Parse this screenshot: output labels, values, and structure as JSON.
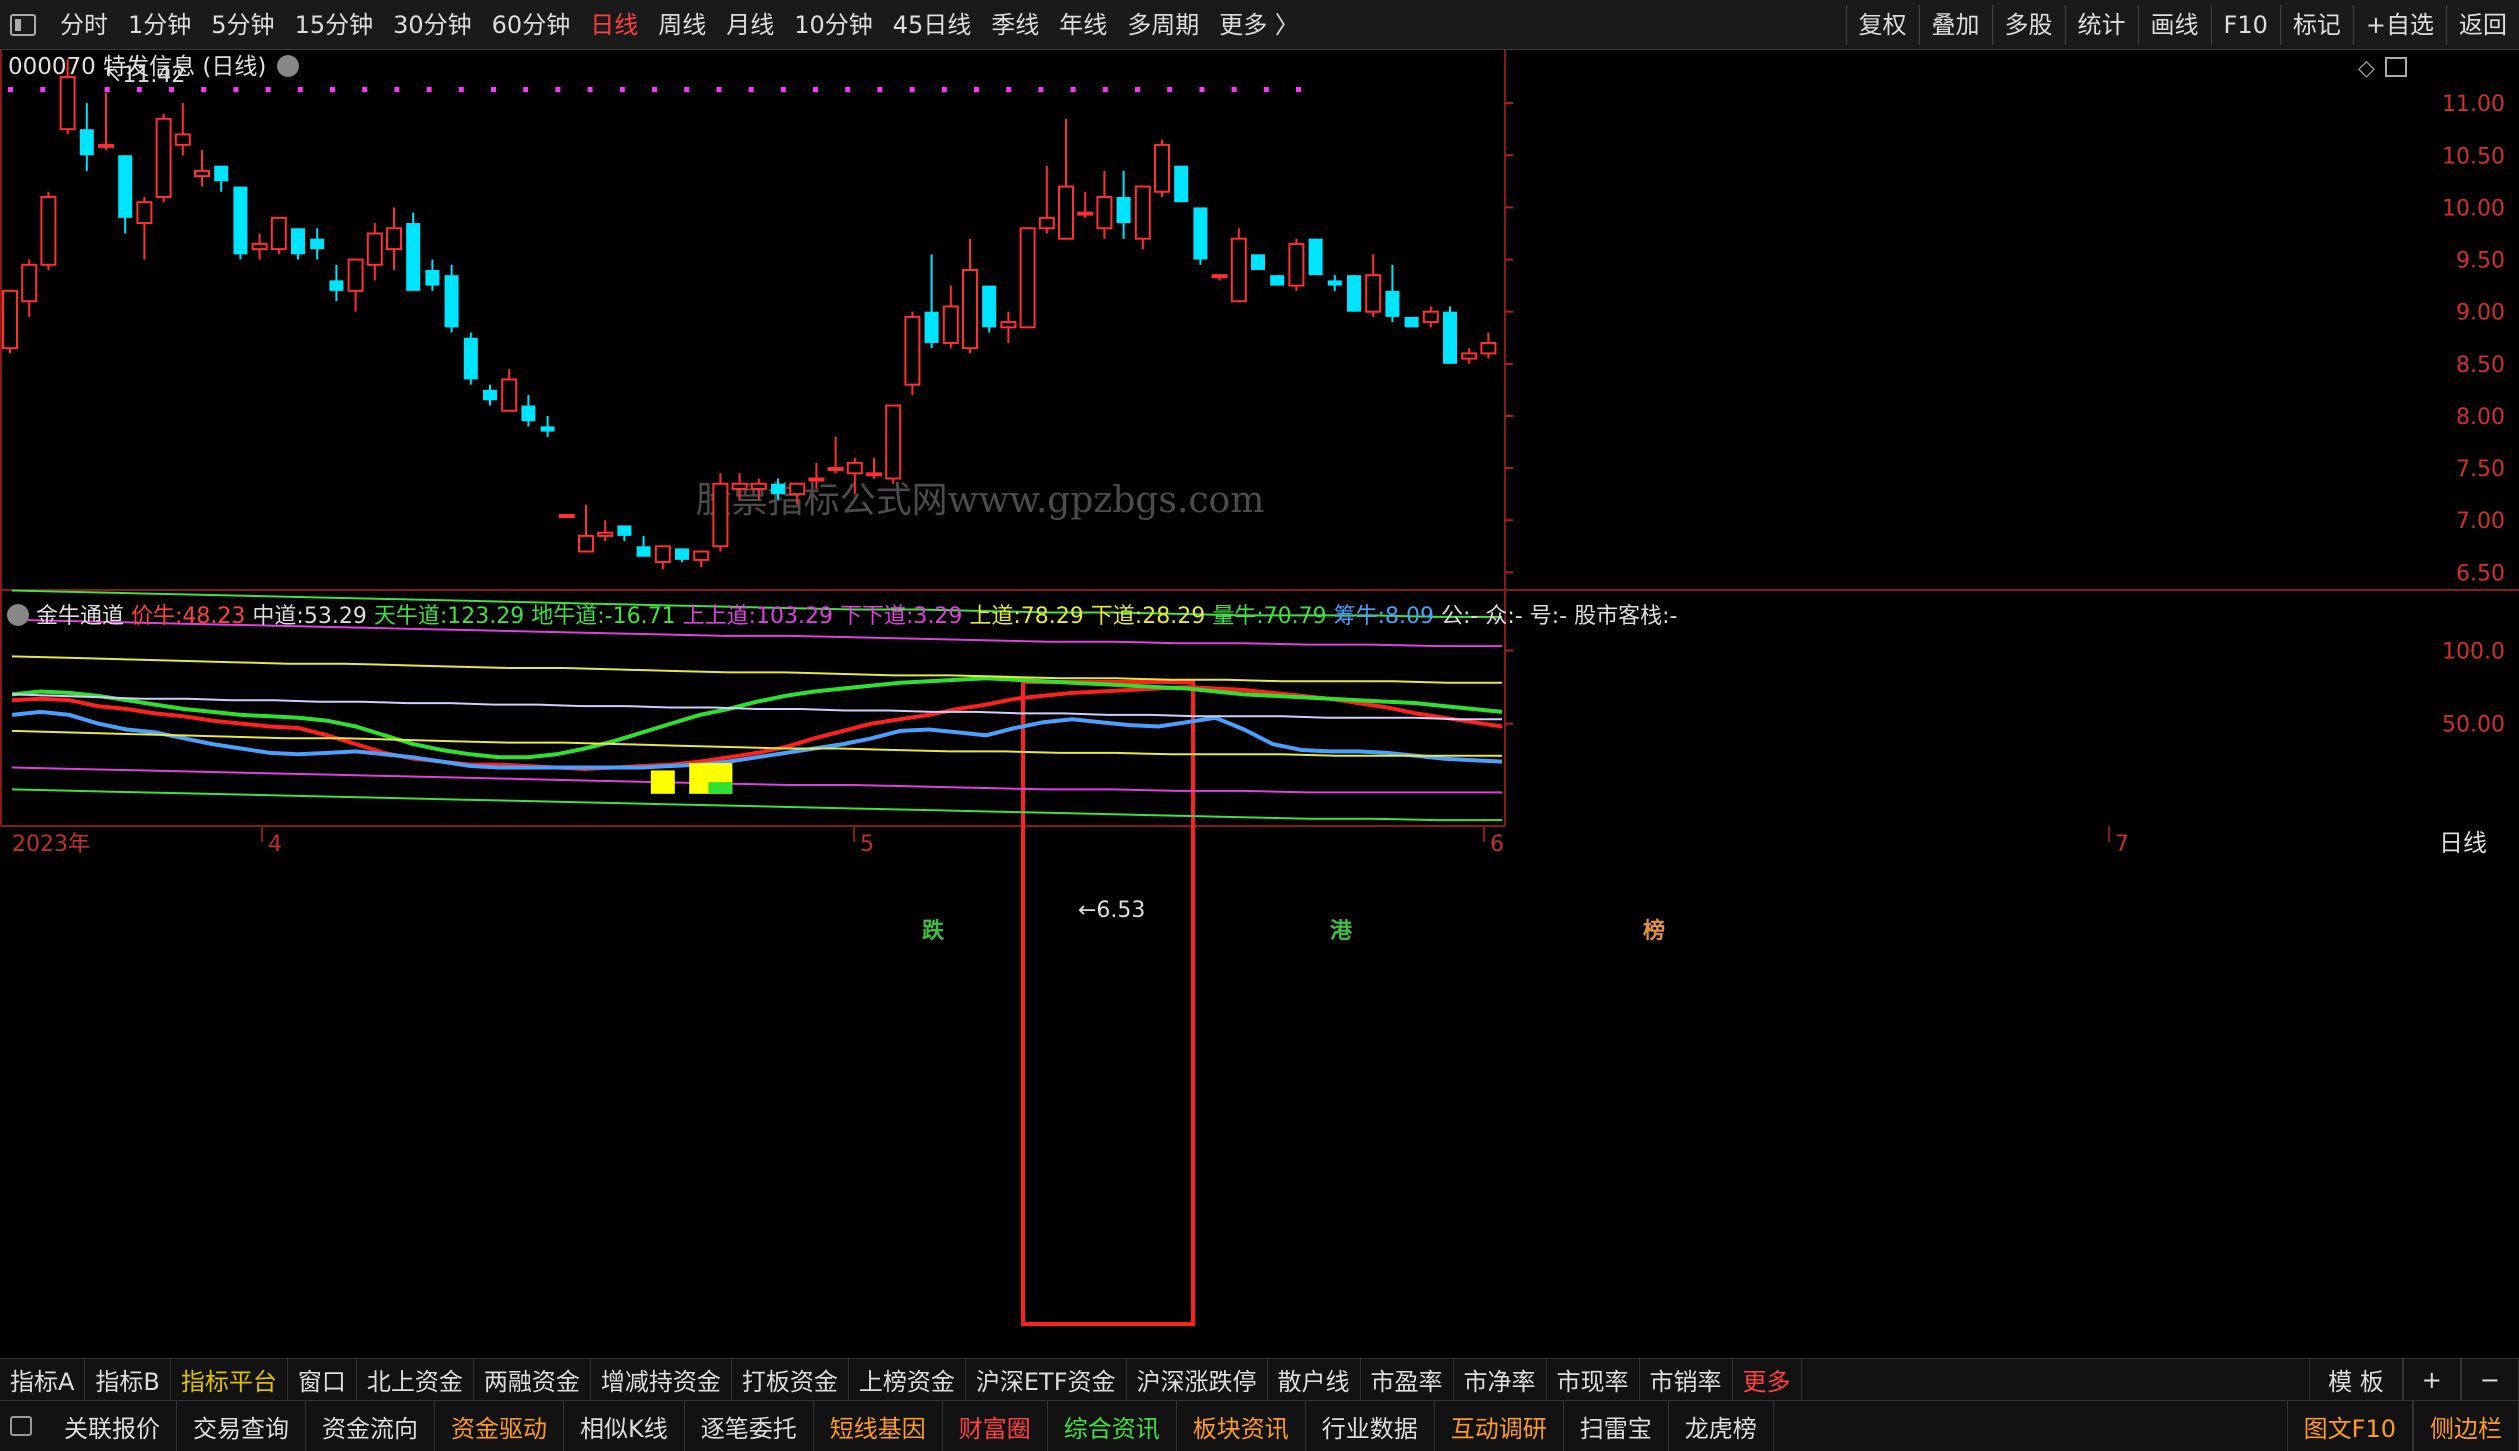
{
  "toolbar": {
    "periods": [
      "分时",
      "1分钟",
      "5分钟",
      "15分钟",
      "30分钟",
      "60分钟",
      "日线",
      "周线",
      "月线",
      "10分钟",
      "45日线",
      "季线",
      "年线",
      "多周期",
      "更多 〉"
    ],
    "active_period": "日线",
    "right_buttons": [
      "复权",
      "叠加",
      "多股",
      "统计",
      "画线",
      "F10",
      "标记",
      "+自选",
      "返回"
    ]
  },
  "stock": {
    "code": "000070",
    "name": "特发信息",
    "period": "(日线)"
  },
  "annotations": {
    "high_label": "11.42",
    "low_label": "6.53",
    "watermark": "股票指标公式网www.gpzbgs.com"
  },
  "markers": [
    {
      "text": "跌",
      "color": "#40c040"
    },
    {
      "text": "港",
      "color": "#40c040"
    },
    {
      "text": "榜",
      "color": "#e09040"
    }
  ],
  "indicator": {
    "name": "金牛通道",
    "values": [
      {
        "label": "价牛:",
        "value": "48.23",
        "color": "#ff4040"
      },
      {
        "label": "中道:",
        "value": "53.29",
        "color": "#dddddd"
      },
      {
        "label": "天牛道:",
        "value": "123.29",
        "color": "#40e040"
      },
      {
        "label": "地牛道:",
        "value": "-16.71",
        "color": "#40e040"
      },
      {
        "label": "上上道:",
        "value": "103.29",
        "color": "#e040e0"
      },
      {
        "label": "下下道:",
        "value": "3.29",
        "color": "#e040e0"
      },
      {
        "label": "上道:",
        "value": "78.29",
        "color": "#e8e840"
      },
      {
        "label": "下道:",
        "value": "28.29",
        "color": "#e8e840"
      },
      {
        "label": "量牛:",
        "value": "70.79",
        "color": "#40e040"
      },
      {
        "label": "筹牛:",
        "value": "8.09",
        "color": "#4aa0ff"
      },
      {
        "label": "公:",
        "value": "-",
        "color": "#dddddd"
      },
      {
        "label": "众:",
        "value": "-",
        "color": "#dddddd"
      },
      {
        "label": "号:",
        "value": "-",
        "color": "#dddddd"
      },
      {
        "label": "股市客栈:",
        "value": "-",
        "color": "#dddddd"
      }
    ]
  },
  "price_axis": [
    "11.00",
    "10.50",
    "10.00",
    "9.50",
    "9.00",
    "8.50",
    "8.00",
    "7.50",
    "7.00",
    "6.50"
  ],
  "indicator_axis": [
    "100.0",
    "50.00"
  ],
  "date_axis": {
    "labels": [
      "2023年",
      "4",
      "5",
      "6",
      "7"
    ],
    "period_label": "日线"
  },
  "bottom_tabs": {
    "row1": [
      "指标A",
      "指标B",
      "指标平台",
      "窗口",
      "北上资金",
      "两融资金",
      "增减持资金",
      "打板资金",
      "上榜资金",
      "沪深ETF资金",
      "沪深涨跌停",
      "散户线",
      "市盈率",
      "市净率",
      "市现率",
      "市销率",
      "更多"
    ],
    "row1_right": [
      "模 板",
      "+",
      "−"
    ],
    "row2": [
      {
        "text": "关联报价",
        "color": "#dddddd"
      },
      {
        "text": "交易查询",
        "color": "#dddddd"
      },
      {
        "text": "资金流向",
        "color": "#dddddd"
      },
      {
        "text": "资金驱动",
        "color": "#ff9a2a"
      },
      {
        "text": "相似K线",
        "color": "#dddddd"
      },
      {
        "text": "逐笔委托",
        "color": "#dddddd"
      },
      {
        "text": "短线基因",
        "color": "#ff9a2a"
      },
      {
        "text": "财富圈",
        "color": "#ff4040"
      },
      {
        "text": "综合资讯",
        "color": "#40e040"
      },
      {
        "text": "板块资讯",
        "color": "#ff9a2a"
      },
      {
        "text": "行业数据",
        "color": "#dddddd"
      },
      {
        "text": "互动调研",
        "color": "#ff9a2a"
      },
      {
        "text": "扫雷宝",
        "color": "#dddddd"
      },
      {
        "text": "龙虎榜",
        "color": "#dddddd"
      }
    ],
    "row2_right": [
      {
        "text": "图文F10",
        "color": "#ff9a2a"
      },
      {
        "text": "侧边栏",
        "color": "#ff9a2a"
      }
    ]
  },
  "chart_data": {
    "type": "candlestick",
    "ylim": [
      6.35,
      11.5
    ],
    "candles": [
      {
        "o": 8.65,
        "h": 9.0,
        "l": 8.6,
        "c": 9.2
      },
      {
        "o": 9.1,
        "h": 9.5,
        "l": 8.95,
        "c": 9.45
      },
      {
        "o": 9.45,
        "h": 10.15,
        "l": 9.4,
        "c": 10.1
      },
      {
        "o": 10.75,
        "h": 11.42,
        "l": 10.7,
        "c": 11.25
      },
      {
        "o": 10.75,
        "h": 11.0,
        "l": 10.35,
        "c": 10.5
      },
      {
        "o": 10.6,
        "h": 11.1,
        "l": 10.55,
        "c": 10.6
      },
      {
        "o": 10.5,
        "h": 10.5,
        "l": 9.75,
        "c": 9.9
      },
      {
        "o": 9.85,
        "h": 10.1,
        "l": 9.5,
        "c": 10.05
      },
      {
        "o": 10.1,
        "h": 10.9,
        "l": 10.05,
        "c": 10.85
      },
      {
        "o": 10.6,
        "h": 11.0,
        "l": 10.5,
        "c": 10.7
      },
      {
        "o": 10.3,
        "h": 10.55,
        "l": 10.2,
        "c": 10.35
      },
      {
        "o": 10.4,
        "h": 10.4,
        "l": 10.15,
        "c": 10.25
      },
      {
        "o": 10.2,
        "h": 10.2,
        "l": 9.5,
        "c": 9.55
      },
      {
        "o": 9.6,
        "h": 9.75,
        "l": 9.5,
        "c": 9.65
      },
      {
        "o": 9.6,
        "h": 9.9,
        "l": 9.55,
        "c": 9.9
      },
      {
        "o": 9.8,
        "h": 9.8,
        "l": 9.5,
        "c": 9.55
      },
      {
        "o": 9.7,
        "h": 9.8,
        "l": 9.5,
        "c": 9.6
      },
      {
        "o": 9.3,
        "h": 9.45,
        "l": 9.1,
        "c": 9.2
      },
      {
        "o": 9.2,
        "h": 9.45,
        "l": 9.0,
        "c": 9.5
      },
      {
        "o": 9.45,
        "h": 9.85,
        "l": 9.3,
        "c": 9.75
      },
      {
        "o": 9.6,
        "h": 10.0,
        "l": 9.4,
        "c": 9.8
      },
      {
        "o": 9.85,
        "h": 9.95,
        "l": 9.2,
        "c": 9.2
      },
      {
        "o": 9.4,
        "h": 9.5,
        "l": 9.2,
        "c": 9.25
      },
      {
        "o": 9.35,
        "h": 9.45,
        "l": 8.8,
        "c": 8.85
      },
      {
        "o": 8.75,
        "h": 8.8,
        "l": 8.3,
        "c": 8.35
      },
      {
        "o": 8.25,
        "h": 8.3,
        "l": 8.1,
        "c": 8.15
      },
      {
        "o": 8.05,
        "h": 8.45,
        "l": 8.05,
        "c": 8.35
      },
      {
        "o": 8.1,
        "h": 8.2,
        "l": 7.9,
        "c": 7.95
      },
      {
        "o": 7.9,
        "h": 8.0,
        "l": 7.8,
        "c": 7.85
      },
      {
        "o": 7.05,
        "h": 7.05,
        "l": 7.05,
        "c": 7.05
      },
      {
        "o": 6.7,
        "h": 7.15,
        "l": 6.7,
        "c": 6.85
      },
      {
        "o": 6.85,
        "h": 7.0,
        "l": 6.8,
        "c": 6.88
      },
      {
        "o": 6.95,
        "h": 6.95,
        "l": 6.8,
        "c": 6.85
      },
      {
        "o": 6.75,
        "h": 6.85,
        "l": 6.65,
        "c": 6.65
      },
      {
        "o": 6.6,
        "h": 6.75,
        "l": 6.53,
        "c": 6.75
      },
      {
        "o": 6.73,
        "h": 6.73,
        "l": 6.6,
        "c": 6.62
      },
      {
        "o": 6.62,
        "h": 6.7,
        "l": 6.55,
        "c": 6.7
      },
      {
        "o": 6.75,
        "h": 7.45,
        "l": 6.7,
        "c": 7.35
      },
      {
        "o": 7.3,
        "h": 7.45,
        "l": 7.2,
        "c": 7.35
      },
      {
        "o": 7.3,
        "h": 7.4,
        "l": 7.2,
        "c": 7.35
      },
      {
        "o": 7.35,
        "h": 7.4,
        "l": 7.2,
        "c": 7.25
      },
      {
        "o": 7.25,
        "h": 7.35,
        "l": 7.15,
        "c": 7.35
      },
      {
        "o": 7.4,
        "h": 7.55,
        "l": 7.3,
        "c": 7.4
      },
      {
        "o": 7.5,
        "h": 7.8,
        "l": 7.45,
        "c": 7.5
      },
      {
        "o": 7.45,
        "h": 7.6,
        "l": 7.25,
        "c": 7.55
      },
      {
        "o": 7.45,
        "h": 7.6,
        "l": 7.4,
        "c": 7.45
      },
      {
        "o": 7.4,
        "h": 8.1,
        "l": 7.35,
        "c": 8.1
      },
      {
        "o": 8.3,
        "h": 9.0,
        "l": 8.2,
        "c": 8.95
      },
      {
        "o": 9.0,
        "h": 9.55,
        "l": 8.65,
        "c": 8.7
      },
      {
        "o": 8.7,
        "h": 9.25,
        "l": 8.65,
        "c": 9.05
      },
      {
        "o": 8.65,
        "h": 9.7,
        "l": 8.6,
        "c": 9.4
      },
      {
        "o": 9.25,
        "h": 9.25,
        "l": 8.8,
        "c": 8.85
      },
      {
        "o": 8.85,
        "h": 9.0,
        "l": 8.7,
        "c": 8.9
      },
      {
        "o": 8.85,
        "h": 9.0,
        "l": 8.85,
        "c": 9.8
      },
      {
        "o": 9.8,
        "h": 10.4,
        "l": 9.75,
        "c": 9.9
      },
      {
        "o": 9.7,
        "h": 10.85,
        "l": 9.7,
        "c": 10.2
      },
      {
        "o": 9.95,
        "h": 10.15,
        "l": 9.9,
        "c": 9.95
      },
      {
        "o": 9.8,
        "h": 10.35,
        "l": 9.7,
        "c": 10.1
      },
      {
        "o": 10.1,
        "h": 10.35,
        "l": 9.7,
        "c": 9.85
      },
      {
        "o": 9.7,
        "h": 10.2,
        "l": 9.6,
        "c": 10.2
      },
      {
        "o": 10.15,
        "h": 10.65,
        "l": 10.1,
        "c": 10.6
      },
      {
        "o": 10.4,
        "h": 10.4,
        "l": 10.05,
        "c": 10.05
      },
      {
        "o": 10.0,
        "h": 10.0,
        "l": 9.45,
        "c": 9.5
      },
      {
        "o": 9.35,
        "h": 9.35,
        "l": 9.3,
        "c": 9.35
      },
      {
        "o": 9.1,
        "h": 9.8,
        "l": 9.1,
        "c": 9.7
      },
      {
        "o": 9.55,
        "h": 9.55,
        "l": 9.4,
        "c": 9.4
      },
      {
        "o": 9.35,
        "h": 9.35,
        "l": 9.25,
        "c": 9.25
      },
      {
        "o": 9.25,
        "h": 9.7,
        "l": 9.2,
        "c": 9.65
      },
      {
        "o": 9.7,
        "h": 9.7,
        "l": 9.35,
        "c": 9.35
      },
      {
        "o": 9.3,
        "h": 9.35,
        "l": 9.2,
        "c": 9.25
      },
      {
        "o": 9.35,
        "h": 9.35,
        "l": 9.0,
        "c": 9.0
      },
      {
        "o": 9.0,
        "h": 9.55,
        "l": 8.95,
        "c": 9.35
      },
      {
        "o": 9.2,
        "h": 9.45,
        "l": 8.9,
        "c": 8.95
      },
      {
        "o": 8.95,
        "h": 8.95,
        "l": 8.85,
        "c": 8.85
      },
      {
        "o": 8.9,
        "h": 9.05,
        "l": 8.85,
        "c": 9.0
      },
      {
        "o": 9.0,
        "h": 9.05,
        "l": 8.5,
        "c": 8.5
      },
      {
        "o": 8.55,
        "h": 8.65,
        "l": 8.5,
        "c": 8.6
      },
      {
        "o": 8.6,
        "h": 8.8,
        "l": 8.55,
        "c": 8.7
      }
    ],
    "indicator": {
      "ylim": [
        -20,
        140
      ],
      "series": [
        {
          "name": "价牛",
          "color": "#ff2020",
          "values": [
            66,
            67,
            66,
            62,
            60,
            57,
            55,
            52,
            50,
            48,
            47,
            42,
            36,
            30,
            26,
            24,
            22,
            22,
            21,
            20,
            19,
            20,
            21,
            22,
            24,
            27,
            30,
            34,
            40,
            45,
            50,
            53,
            56,
            60,
            63,
            67,
            69,
            71,
            72,
            73,
            74,
            75,
            74,
            73,
            71,
            69,
            67,
            64,
            61,
            57,
            54,
            51,
            48
          ]
        },
        {
          "name": "量牛",
          "color": "#30e030",
          "values": [
            70,
            72,
            71,
            69,
            66,
            63,
            60,
            58,
            56,
            55,
            54,
            52,
            48,
            42,
            36,
            32,
            29,
            27,
            27,
            29,
            33,
            38,
            44,
            50,
            56,
            60,
            65,
            69,
            72,
            74,
            76,
            78,
            79,
            80,
            81,
            80,
            79,
            78,
            77,
            76,
            75,
            74,
            72,
            70,
            69,
            68,
            67,
            66,
            65,
            64,
            62,
            60,
            58
          ]
        },
        {
          "name": "筹牛",
          "color": "#4aa0ff",
          "values": [
            56,
            58,
            56,
            50,
            46,
            44,
            40,
            36,
            33,
            30,
            29,
            30,
            31,
            29,
            27,
            24,
            21,
            20,
            20,
            20,
            20,
            20,
            20,
            21,
            22,
            24,
            27,
            30,
            33,
            36,
            40,
            45,
            46,
            44,
            42,
            47,
            51,
            53,
            51,
            49,
            48,
            51,
            54,
            46,
            36,
            32,
            31,
            31,
            30,
            28,
            26,
            25,
            24
          ]
        },
        {
          "name": "中道",
          "color": "#cfcfff",
          "values": [
            70,
            69,
            68,
            67,
            67,
            66,
            66,
            65,
            65,
            64,
            64,
            63,
            63,
            62,
            62,
            61,
            61,
            60,
            60,
            59,
            59,
            58,
            58,
            57,
            57,
            56,
            56,
            55,
            55,
            55,
            54,
            54,
            54,
            53,
            53
          ]
        },
        {
          "name": "上道",
          "color": "#e8e840",
          "values": [
            96,
            95,
            94,
            93,
            92,
            91,
            91,
            90,
            89,
            88,
            88,
            87,
            86,
            85,
            85,
            84,
            83,
            83,
            82,
            81,
            81,
            80,
            80,
            79,
            79,
            79,
            78,
            78
          ]
        },
        {
          "name": "下道",
          "color": "#e8e840",
          "values": [
            45,
            44,
            43,
            42,
            41,
            40,
            40,
            39,
            38,
            37,
            37,
            36,
            35,
            34,
            33,
            33,
            32,
            31,
            31,
            30,
            30,
            29,
            29,
            29,
            28,
            28,
            28,
            28
          ]
        },
        {
          "name": "上上道",
          "color": "#e040e0",
          "values": [
            121,
            120,
            119,
            118,
            117,
            116,
            115,
            114,
            113,
            112,
            111,
            110,
            110,
            109,
            108,
            107,
            106,
            106,
            105,
            105,
            104,
            104,
            103,
            103
          ]
        },
        {
          "name": "下下道",
          "color": "#e040e0",
          "values": [
            20,
            19,
            18,
            17,
            16,
            15,
            14,
            13,
            12,
            11,
            10,
            9,
            8,
            8,
            7,
            6,
            5,
            5,
            4,
            4,
            3,
            3,
            3,
            3
          ]
        },
        {
          "name": "天牛道",
          "color": "#40e040",
          "values": [
            141,
            140,
            139,
            138,
            137,
            136,
            135,
            134,
            133,
            132,
            131,
            130,
            129,
            128,
            128,
            127,
            126,
            126,
            125,
            124,
            124,
            124,
            123,
            123
          ]
        },
        {
          "name": "地牛道",
          "color": "#40e040",
          "values": [
            5,
            4,
            3,
            2,
            1,
            0,
            -1,
            -2,
            -3,
            -4,
            -5,
            -6,
            -7,
            -8,
            -9,
            -10,
            -11,
            -12,
            -13,
            -14,
            -15,
            -15,
            -16,
            -16
          ]
        }
      ],
      "signal_bars": [
        {
          "index": 34,
          "top": 18,
          "bottom": 2,
          "color": "#ffff00"
        },
        {
          "index": 36,
          "top": 23,
          "bottom": 2,
          "color": "#ffff00"
        },
        {
          "index": 37,
          "top": 23,
          "bottom": 2,
          "color": "#ffff00"
        },
        {
          "index": 37,
          "top": 10,
          "bottom": 2,
          "color": "#30e030"
        }
      ]
    }
  }
}
